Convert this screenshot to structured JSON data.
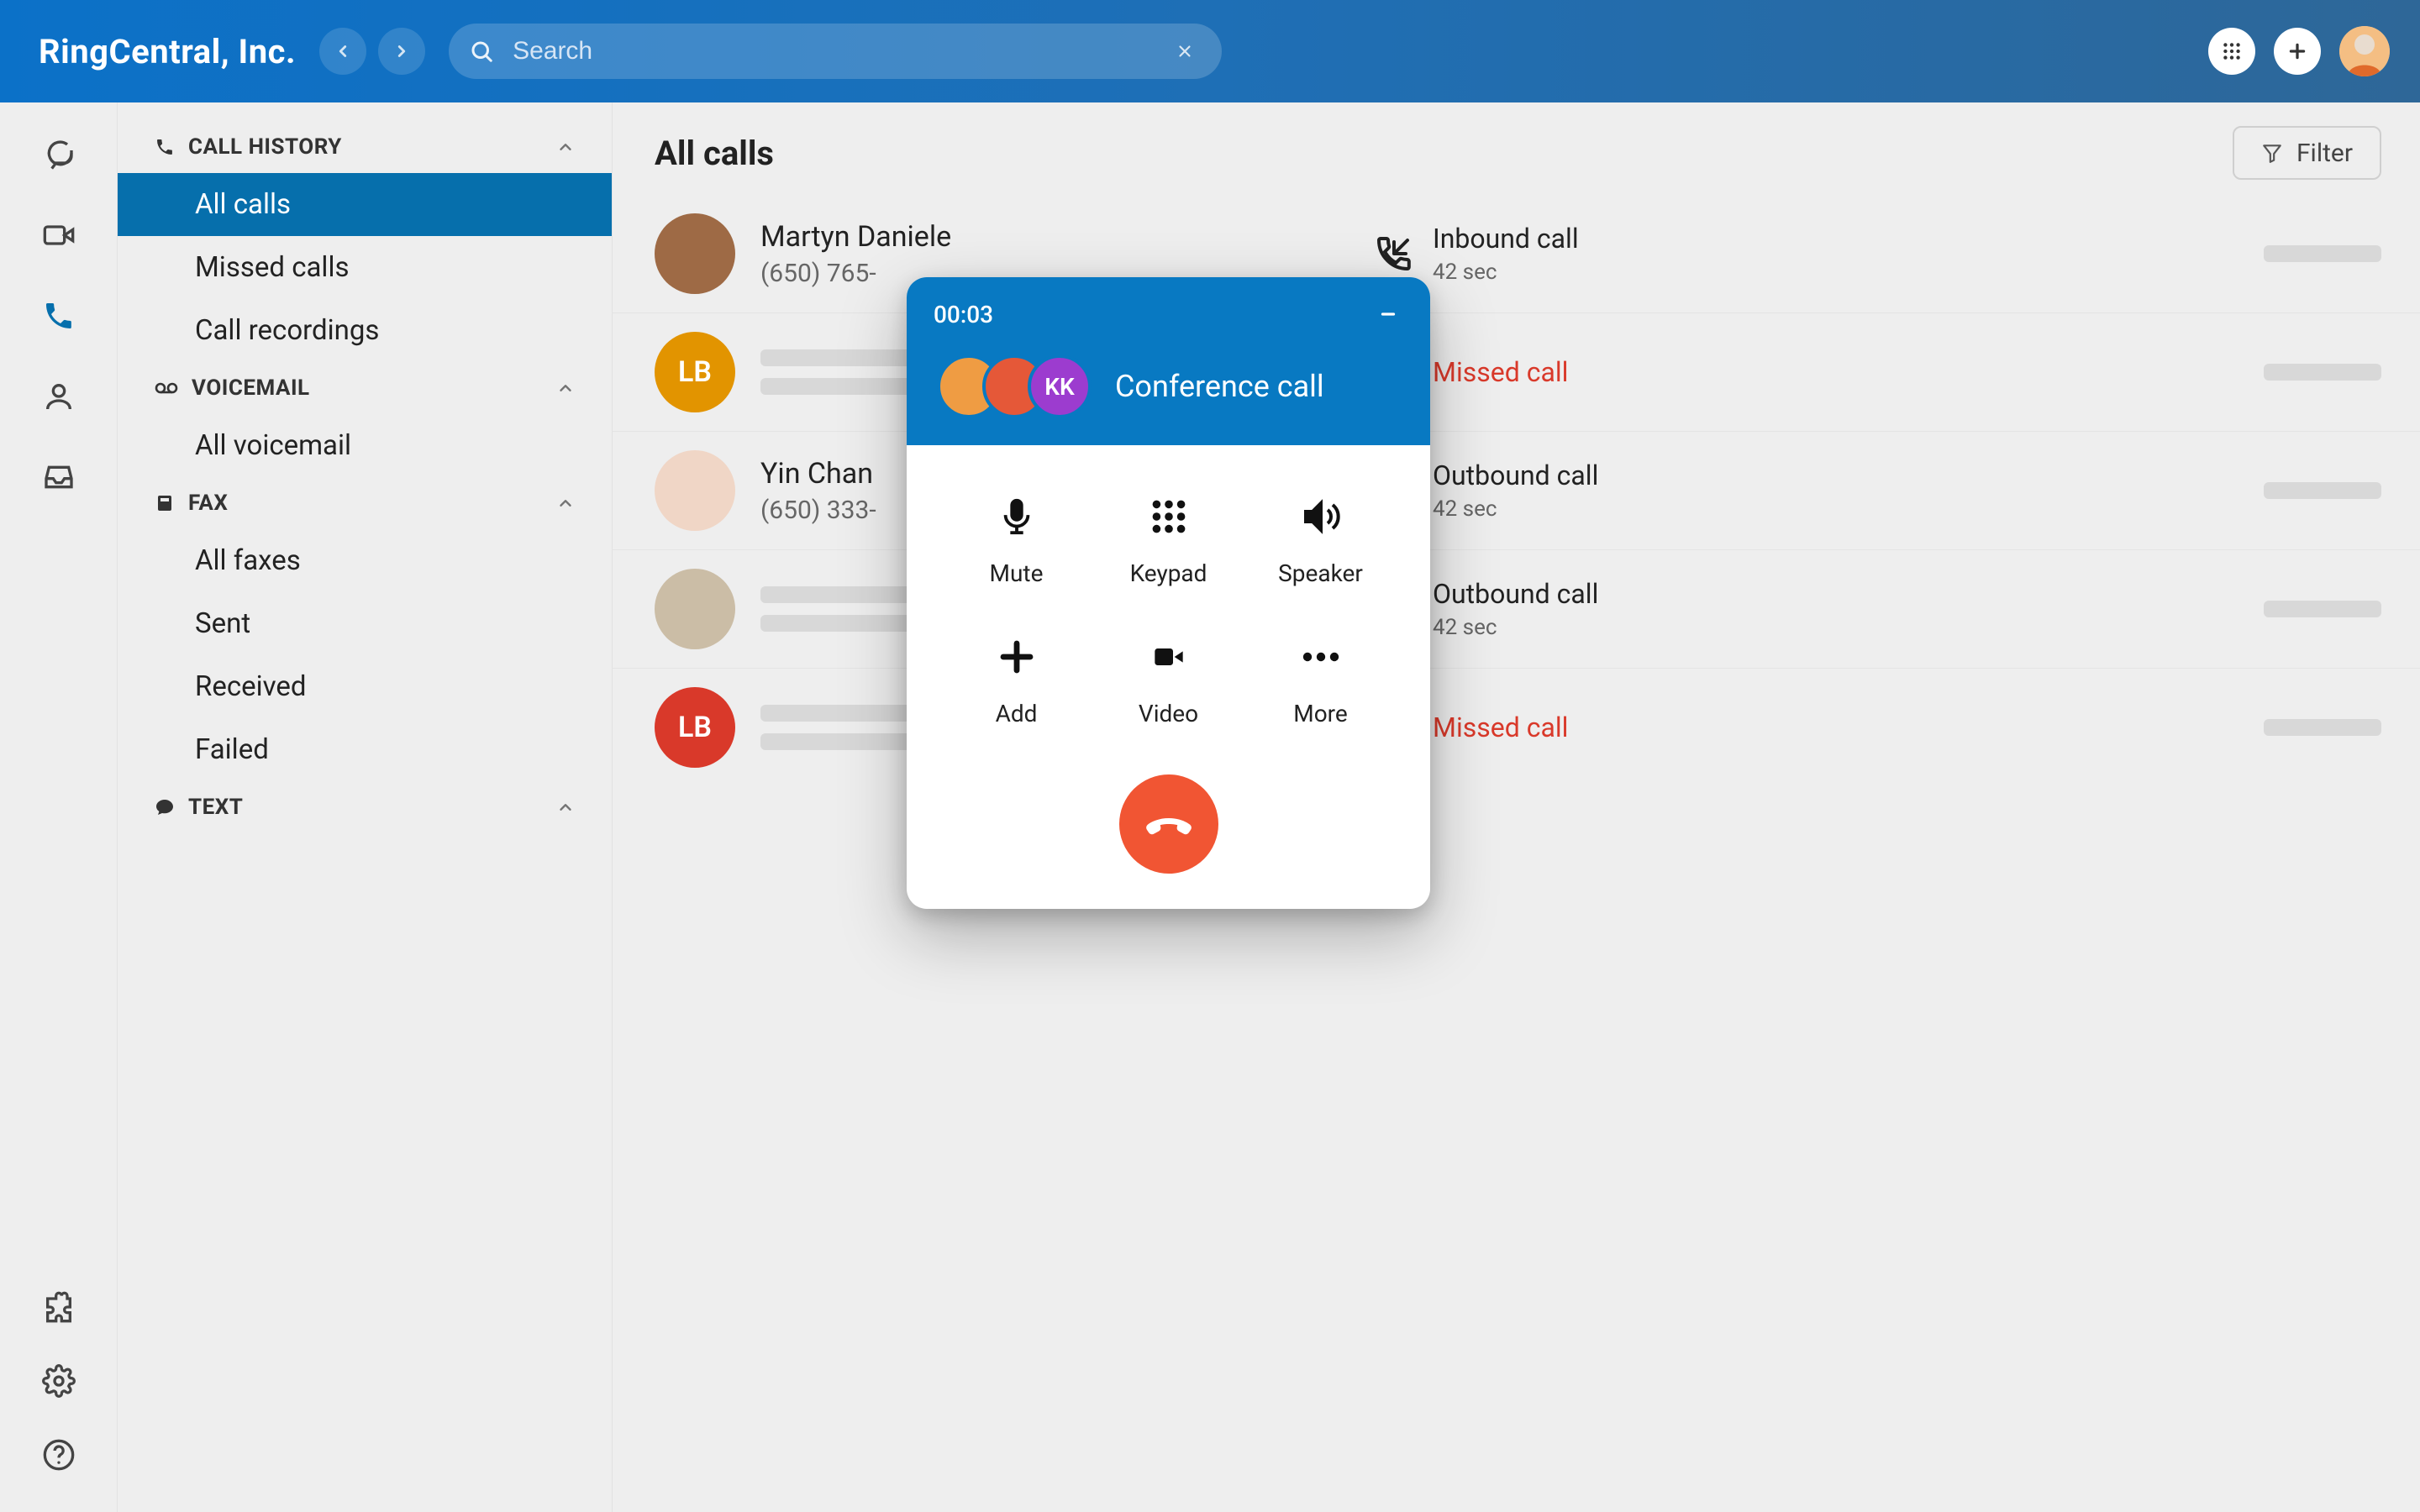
{
  "colors": {
    "primary": "#066fac",
    "headerGradientFrom": "#0b71c8",
    "headerGradientTo": "#2e6798",
    "missed": "#d9392a",
    "hang": "#f15533"
  },
  "header": {
    "brand": "RingCentral, Inc.",
    "search_placeholder": "Search"
  },
  "rail": {
    "items": [
      {
        "id": "messages",
        "icon": "chat-icon"
      },
      {
        "id": "video",
        "icon": "video-icon"
      },
      {
        "id": "phone",
        "icon": "phone-icon",
        "active": true
      },
      {
        "id": "contacts",
        "icon": "contact-icon"
      },
      {
        "id": "inbox",
        "icon": "inbox-icon"
      }
    ],
    "bottom": [
      {
        "id": "apps",
        "icon": "puzzle-icon"
      },
      {
        "id": "settings",
        "icon": "gear-icon"
      },
      {
        "id": "help",
        "icon": "help-icon"
      }
    ]
  },
  "sidebar": {
    "sections": [
      {
        "id": "call-history",
        "icon": "phone-small-icon",
        "label": "CALL HISTORY",
        "items": [
          {
            "label": "All calls",
            "selected": true
          },
          {
            "label": "Missed calls"
          },
          {
            "label": "Call recordings"
          }
        ]
      },
      {
        "id": "voicemail",
        "icon": "voicemail-icon",
        "label": "VOICEMAIL",
        "items": [
          {
            "label": "All voicemail"
          }
        ]
      },
      {
        "id": "fax",
        "icon": "fax-icon",
        "label": "FAX",
        "items": [
          {
            "label": "All faxes"
          },
          {
            "label": "Sent"
          },
          {
            "label": "Received"
          },
          {
            "label": "Failed"
          }
        ]
      },
      {
        "id": "text",
        "icon": "text-icon",
        "label": "TEXT",
        "items": []
      }
    ]
  },
  "main": {
    "title": "All calls",
    "filter_label": "Filter",
    "rows": [
      {
        "avatar": {
          "type": "photo",
          "class": "img1"
        },
        "name": "Martyn Daniele",
        "phone": "(650) 765-",
        "type": "inbound",
        "label": "Inbound call",
        "duration": "42 sec"
      },
      {
        "avatar": {
          "type": "initials",
          "text": "LB",
          "class": "orange"
        },
        "name": "",
        "phone": "",
        "type": "missed",
        "label": "Missed call",
        "duration": ""
      },
      {
        "avatar": {
          "type": "photo",
          "class": "img2"
        },
        "name": "Yin Chan",
        "phone": "(650) 333-",
        "type": "outbound",
        "label": "Outbound call",
        "duration": "42 sec"
      },
      {
        "avatar": {
          "type": "photo",
          "class": "img3"
        },
        "name": "",
        "phone": "",
        "type": "outbound",
        "label": "Outbound call",
        "duration": "42 sec"
      },
      {
        "avatar": {
          "type": "initials",
          "text": "LB",
          "class": "red"
        },
        "name": "",
        "phone": "",
        "type": "missed",
        "label": "Missed call",
        "duration": ""
      }
    ]
  },
  "call_panel": {
    "timer": "00:03",
    "title": "Conference call",
    "participants": [
      {
        "display": "",
        "class": "c1"
      },
      {
        "display": "",
        "class": "c2"
      },
      {
        "display": "KK",
        "class": "c3"
      }
    ],
    "controls": [
      {
        "id": "mute",
        "label": "Mute"
      },
      {
        "id": "keypad",
        "label": "Keypad"
      },
      {
        "id": "speaker",
        "label": "Speaker"
      },
      {
        "id": "add",
        "label": "Add"
      },
      {
        "id": "video",
        "label": "Video"
      },
      {
        "id": "more",
        "label": "More"
      }
    ]
  }
}
